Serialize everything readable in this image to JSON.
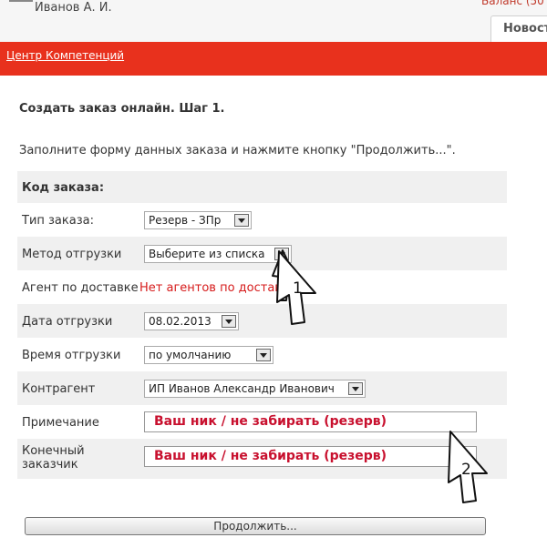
{
  "header": {
    "user_name": "Иванов А. И.",
    "balance_text": "Баланс (50",
    "tab_news": "Новост"
  },
  "nav": {
    "competence_center": "Центр Компетенций"
  },
  "page": {
    "title": "Создать заказ онлайн. Шаг 1.",
    "instruction": "Заполните форму данных заказа и нажмите кнопку \"Продолжить...\"."
  },
  "form": {
    "section_title": "Код заказа:",
    "order_type": {
      "label": "Тип заказа:",
      "value": "Резерв - ЗПр"
    },
    "shipping_method": {
      "label": "Метод отгрузки",
      "value": "Выберите из списка"
    },
    "delivery_agent": {
      "label": "Агент по доставке",
      "value": "Нет агентов по доставке"
    },
    "shipping_date": {
      "label": "Дата отгрузки",
      "value": "08.02.2013"
    },
    "shipping_time": {
      "label": "Время отгрузки",
      "value": "по умолчанию"
    },
    "counterparty": {
      "label": "Контрагент",
      "value": "ИП Иванов Александр Иванович"
    },
    "note": {
      "label": "Примечание",
      "value": "Ваш ник / не забирать (резерв)"
    },
    "end_customer": {
      "label": "Конечный заказчик",
      "value": "Ваш ник / не забирать (резерв)"
    },
    "continue_button": "Продолжить..."
  },
  "annotations": {
    "callout_1": "1",
    "callout_2": "2"
  }
}
